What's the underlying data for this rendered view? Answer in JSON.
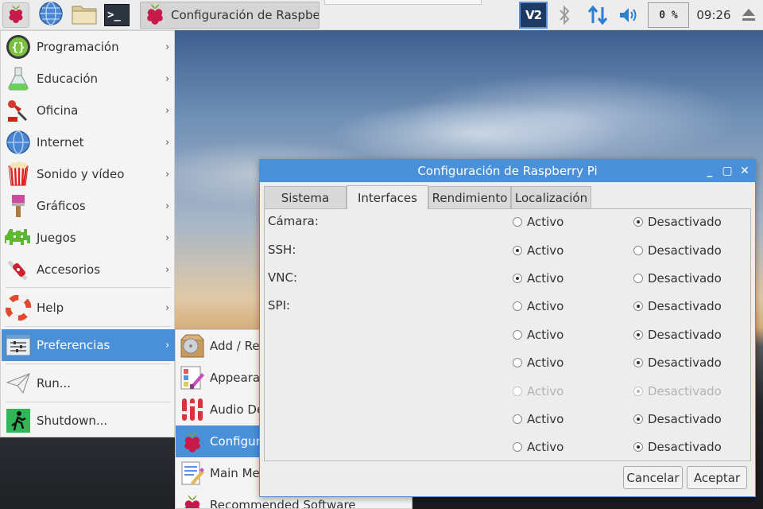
{
  "taskbar": {
    "task_label": "Configuración de Raspbe…",
    "vnc_label": "V2",
    "cpu_label": "0 %",
    "clock": "09:26",
    "icons": [
      "raspberry-icon",
      "globe-icon",
      "folder-icon",
      "terminal-icon",
      "vnc-icon",
      "bluetooth-icon",
      "network-icon",
      "volume-icon",
      "eject-icon"
    ],
    "terminal_glyph": ">_"
  },
  "main_menu": {
    "items": [
      {
        "label": "Programación",
        "icon": "programming-icon",
        "arrow": "›"
      },
      {
        "label": "Educación",
        "icon": "education-icon",
        "arrow": "›"
      },
      {
        "label": "Oficina",
        "icon": "office-icon",
        "arrow": "›"
      },
      {
        "label": "Internet",
        "icon": "internet-icon",
        "arrow": "›"
      },
      {
        "label": "Sonido y vídeo",
        "icon": "sound-video-icon",
        "arrow": "›"
      },
      {
        "label": "Gráficos",
        "icon": "graphics-icon",
        "arrow": "›"
      },
      {
        "label": "Juegos",
        "icon": "games-icon",
        "arrow": "›"
      },
      {
        "label": "Accesorios",
        "icon": "accessories-icon",
        "arrow": "›"
      },
      {
        "label": "Help",
        "icon": "help-icon",
        "arrow": "›"
      },
      {
        "label": "Preferencias",
        "icon": "preferences-icon",
        "arrow": "›"
      },
      {
        "label": "Run...",
        "icon": "run-icon",
        "arrow": ""
      },
      {
        "label": "Shutdown...",
        "icon": "shutdown-icon",
        "arrow": ""
      }
    ],
    "active": "Preferencias"
  },
  "submenu": {
    "items": [
      {
        "label": "Add / Remove Software",
        "icon": "add-remove-software-icon"
      },
      {
        "label": "Appearance Settings",
        "icon": "appearance-settings-icon"
      },
      {
        "label": "Audio Device Settings",
        "icon": "audio-device-settings-icon"
      },
      {
        "label": "Configuración de Raspberry Pi",
        "icon": "raspberry-icon"
      },
      {
        "label": "Main Menu Editor",
        "icon": "main-menu-editor-icon"
      },
      {
        "label": "Recommended Software",
        "icon": "raspberry-icon"
      }
    ],
    "active": "Configuración de Raspberry Pi"
  },
  "dialog": {
    "title": "Configuración de Raspberry Pi",
    "controls": {
      "minimize": "_",
      "maximize": "▢",
      "close": "✕"
    },
    "tabs": [
      "Sistema",
      "Interfaces",
      "Rendimiento",
      "Localización"
    ],
    "active_tab": "Interfaces",
    "option_on": "Activo",
    "option_off": "Desactivado",
    "rows": [
      {
        "name": "Cámara:",
        "selected": "off",
        "disabled": false
      },
      {
        "name": "SSH:",
        "selected": "on",
        "disabled": false
      },
      {
        "name": "VNC:",
        "selected": "on",
        "disabled": false
      },
      {
        "name": "SPI:",
        "selected": "off",
        "disabled": false
      },
      {
        "name": "",
        "selected": "off",
        "disabled": false
      },
      {
        "name": "",
        "selected": "off",
        "disabled": false
      },
      {
        "name": "",
        "selected": "off",
        "disabled": true
      },
      {
        "name": "",
        "selected": "off",
        "disabled": false
      },
      {
        "name": "",
        "selected": "off",
        "disabled": false
      }
    ],
    "buttons": {
      "cancel": "Cancelar",
      "accept": "Aceptar"
    }
  },
  "colors": {
    "accent": "#4a90d9",
    "raspberry": "#c51a4a",
    "leaf": "#75a928"
  }
}
